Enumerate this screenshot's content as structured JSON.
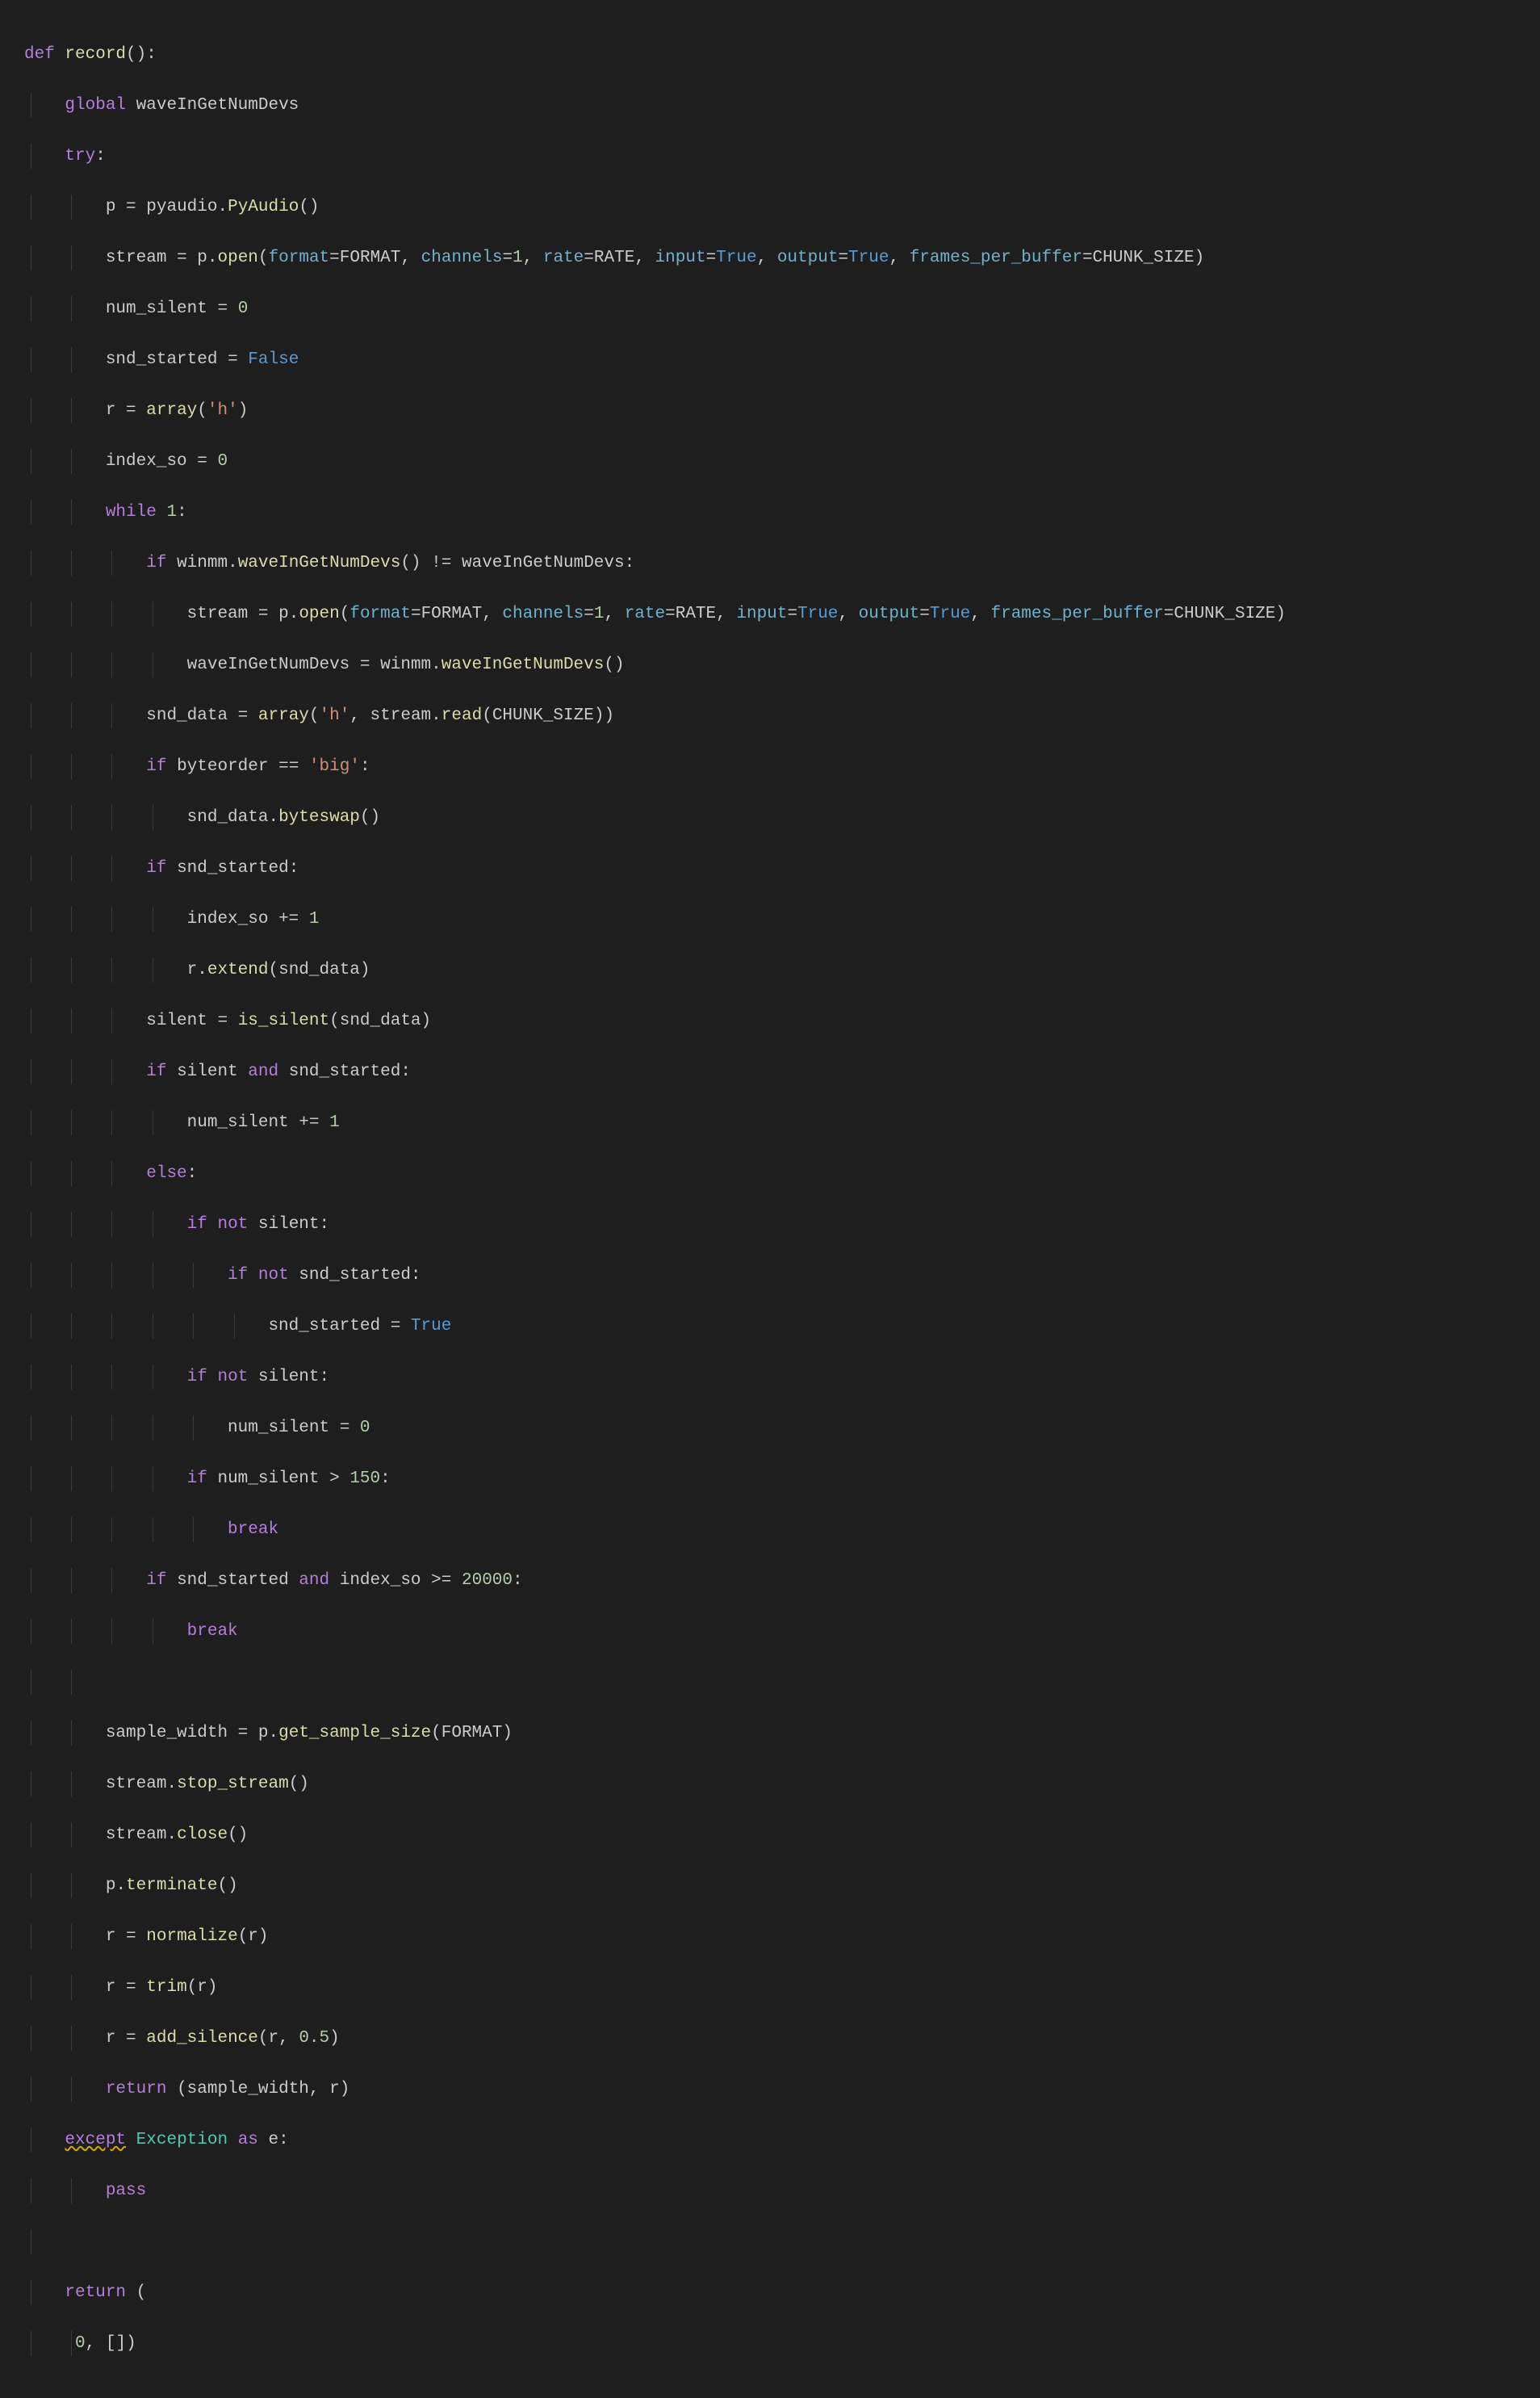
{
  "code": {
    "l1": {
      "def": "def",
      "fn": "record",
      "paren": "():"
    },
    "l2": {
      "global": "global",
      "name": "waveInGetNumDevs"
    },
    "l3": {
      "try": "try",
      "colon": ":"
    },
    "l4": {
      "p": "p",
      "eq": "=",
      "pyaudio": "pyaudio",
      "dot": ".",
      "PyAudio": "PyAudio",
      "paren": "()"
    },
    "l5": {
      "stream": "stream",
      "eq": "=",
      "p": "p",
      "open": "open",
      "format": "format",
      "FORMAT": "FORMAT",
      "channels": "channels",
      "one": "1",
      "rate": "rate",
      "RATE": "RATE",
      "input": "input",
      "true1": "True",
      "output": "output",
      "true2": "True",
      "fpb": "frames_per_buffer",
      "CHUNK": "CHUNK_SIZE"
    },
    "l6": {
      "num_silent": "num_silent",
      "eq": "=",
      "zero": "0"
    },
    "l7": {
      "snd_started": "snd_started",
      "eq": "=",
      "false": "False"
    },
    "l8": {
      "r": "r",
      "eq": "=",
      "array": "array",
      "h": "'h'"
    },
    "l9": {
      "index_so": "index_so",
      "eq": "=",
      "zero": "0"
    },
    "l10": {
      "while": "while",
      "one": "1",
      "colon": ":"
    },
    "l11": {
      "if": "if",
      "winmm": "winmm",
      "dot": ".",
      "wave": "waveInGetNumDevs",
      "paren": "()",
      "neq": "!=",
      "wave2": "waveInGetNumDevs",
      "colon": ":"
    },
    "l12": {
      "stream": "stream",
      "eq": "=",
      "p": "p",
      "open": "open",
      "format": "format",
      "FORMAT": "FORMAT",
      "channels": "channels",
      "one": "1",
      "rate": "rate",
      "RATE": "RATE",
      "input": "input",
      "true1": "True",
      "output": "output",
      "true2": "True",
      "fpb": "frames_per_buffer",
      "CHUNK": "CHUNK_SIZE"
    },
    "l13": {
      "wave": "waveInGetNumDevs",
      "eq": "=",
      "winmm": "winmm",
      "dot": ".",
      "wave2": "waveInGetNumDevs",
      "paren": "()"
    },
    "l14": {
      "snd_data": "snd_data",
      "eq": "=",
      "array": "array",
      "h": "'h'",
      "comma": ",",
      "stream": "stream",
      "dot": ".",
      "read": "read",
      "CHUNK": "CHUNK_SIZE"
    },
    "l15": {
      "if": "if",
      "byteorder": "byteorder",
      "eqeq": "==",
      "big": "'big'",
      "colon": ":"
    },
    "l16": {
      "snd_data": "snd_data",
      "dot": ".",
      "byteswap": "byteswap",
      "paren": "()"
    },
    "l17": {
      "if": "if",
      "snd_started": "snd_started",
      "colon": ":"
    },
    "l18": {
      "index_so": "index_so",
      "pluseq": "+=",
      "one": "1"
    },
    "l19": {
      "r": "r",
      "dot": ".",
      "extend": "extend",
      "snd_data": "snd_data"
    },
    "l20": {
      "silent": "silent",
      "eq": "=",
      "is_silent": "is_silent",
      "snd_data": "snd_data"
    },
    "l21": {
      "if": "if",
      "silent": "silent",
      "and": "and",
      "snd_started": "snd_started",
      "colon": ":"
    },
    "l22": {
      "num_silent": "num_silent",
      "pluseq": "+=",
      "one": "1"
    },
    "l23": {
      "else": "else",
      "colon": ":"
    },
    "l24": {
      "if": "if",
      "not": "not",
      "silent": "silent",
      "colon": ":"
    },
    "l25": {
      "if": "if",
      "not": "not",
      "snd_started": "snd_started",
      "colon": ":"
    },
    "l26": {
      "snd_started": "snd_started",
      "eq": "=",
      "true": "True"
    },
    "l27": {
      "if": "if",
      "not": "not",
      "silent": "silent",
      "colon": ":"
    },
    "l28": {
      "num_silent": "num_silent",
      "eq": "=",
      "zero": "0"
    },
    "l29": {
      "if": "if",
      "num_silent": "num_silent",
      "gt": ">",
      "n": "150",
      "colon": ":"
    },
    "l30": {
      "break": "break"
    },
    "l31": {
      "if": "if",
      "snd_started": "snd_started",
      "and": "and",
      "index_so": "index_so",
      "gte": ">=",
      "n": "20000",
      "colon": ":"
    },
    "l32": {
      "break": "break"
    },
    "l34": {
      "sample_width": "sample_width",
      "eq": "=",
      "p": "p",
      "dot": ".",
      "get": "get_sample_size",
      "FORMAT": "FORMAT"
    },
    "l35": {
      "stream": "stream",
      "dot": ".",
      "stop": "stop_stream",
      "paren": "()"
    },
    "l36": {
      "stream": "stream",
      "dot": ".",
      "close": "close",
      "paren": "()"
    },
    "l37": {
      "p": "p",
      "dot": ".",
      "terminate": "terminate",
      "paren": "()"
    },
    "l38": {
      "r": "r",
      "eq": "=",
      "normalize": "normalize",
      "r2": "r"
    },
    "l39": {
      "r": "r",
      "eq": "=",
      "trim": "trim",
      "r2": "r"
    },
    "l40": {
      "r": "r",
      "eq": "=",
      "add_silence": "add_silence",
      "r2": "r",
      "comma": ",",
      "n": "0.5"
    },
    "l41": {
      "return": "return",
      "lp": "(",
      "sample_width": "sample_width",
      "comma": ",",
      "r": "r",
      "rp": ")"
    },
    "l42": {
      "except": "except",
      "Exception": "Exception",
      "as": "as",
      "e": "e",
      "colon": ":"
    },
    "l43": {
      "pass": "pass"
    },
    "l45": {
      "return": "return",
      "lp": "("
    },
    "l46": {
      "zero": "0",
      "comma": ",",
      "br": "[]",
      "rp": ")"
    }
  }
}
